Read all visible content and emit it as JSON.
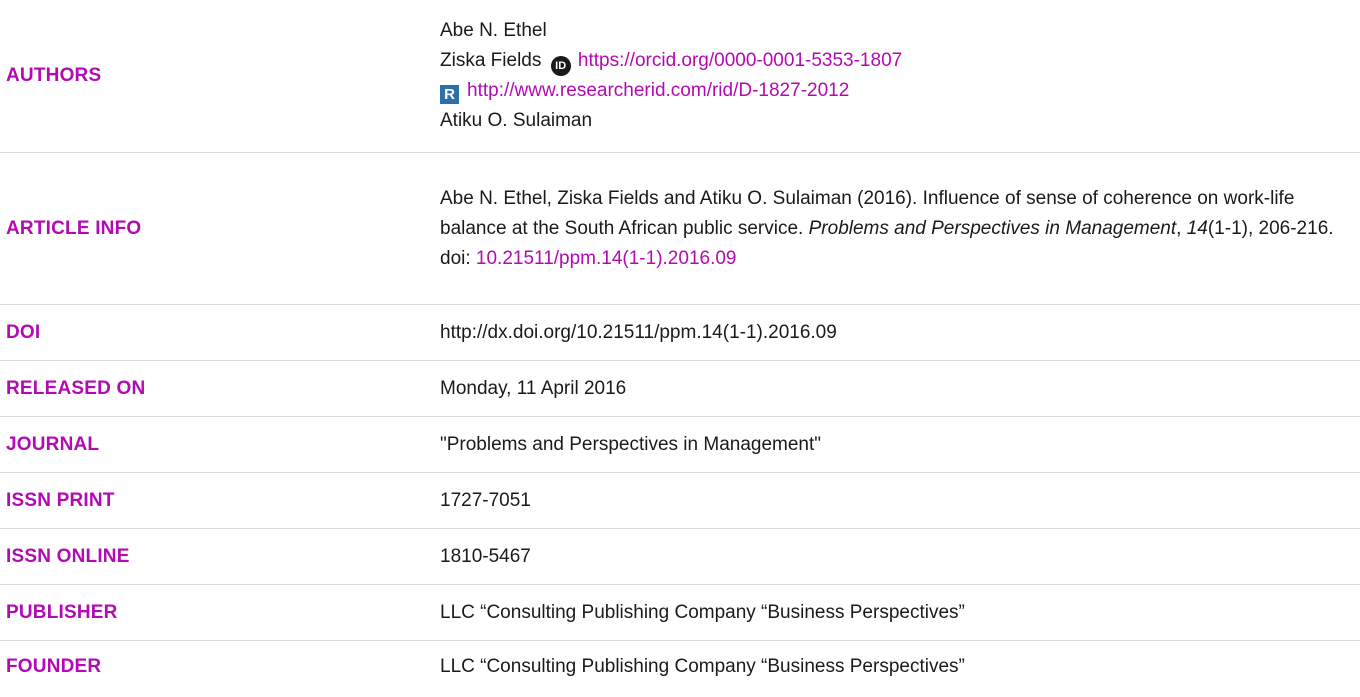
{
  "authors": {
    "label": "AUTHORS",
    "list": [
      {
        "name": "Abe N. Ethel"
      },
      {
        "name": "Ziska Fields",
        "orcid_url": "https://orcid.org/0000-0001-5353-1807",
        "orcid_icon": "ID",
        "researcherid_url": "http://www.researcherid.com/rid/D-1827-2012",
        "researcherid_icon": "R"
      },
      {
        "name": "Atiku O. Sulaiman"
      }
    ]
  },
  "article_info": {
    "label": "ARTICLE INFO",
    "citation_prefix": "Abe N. Ethel, Ziska Fields and Atiku O. Sulaiman (2016). Influence of sense of coherence on work-life balance at the South African public service.",
    "journal_italic": "Problems and Perspectives in Management",
    "volume_italic": "14",
    "issue_pages": "(1-1), 206-216. doi:",
    "doi_link": "10.21511/ppm.14(1-1).2016.09"
  },
  "doi": {
    "label": "DOI",
    "value": "http://dx.doi.org/10.21511/ppm.14(1-1).2016.09"
  },
  "released_on": {
    "label": "RELEASED ON",
    "value": "Monday, 11 April 2016"
  },
  "journal": {
    "label": "JOURNAL",
    "value": "\"Problems and Perspectives in Management\""
  },
  "issn_print": {
    "label": "ISSN PRINT",
    "value": "1727-7051"
  },
  "issn_online": {
    "label": "ISSN ONLINE",
    "value": "1810-5467"
  },
  "publisher": {
    "label": "PUBLISHER",
    "value": "LLC “Consulting Publishing Company “Business Perspectives”"
  },
  "founder": {
    "label": "FOUNDER",
    "value": "LLC “Consulting Publishing Company “Business Perspectives”"
  },
  "colors": {
    "label": "#b30ab3",
    "text": "#1a1a1a",
    "divider": "#d9d9d9",
    "researcherid_badge": "#2d6fa8"
  }
}
